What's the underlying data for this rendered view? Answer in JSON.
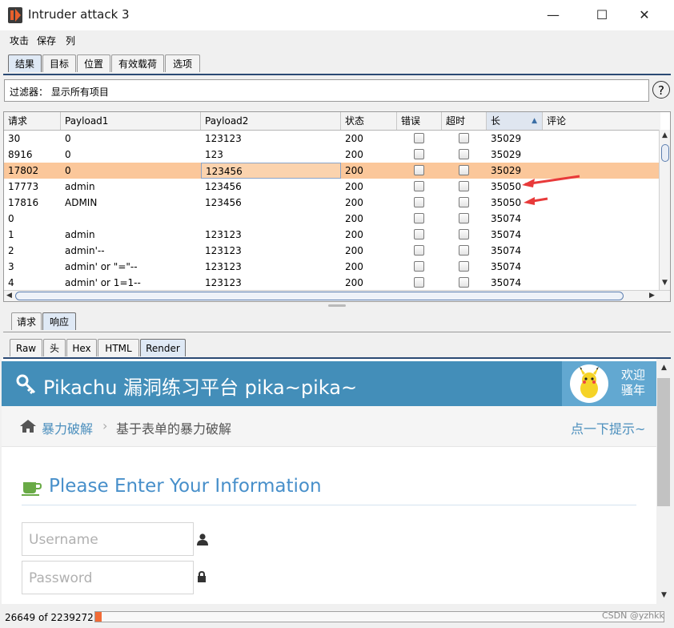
{
  "window": {
    "title": "Intruder attack 3",
    "minimize": "—",
    "maximize": "☐",
    "close": "✕"
  },
  "menu": [
    "攻击",
    "保存",
    "列"
  ],
  "main_tabs": [
    "结果",
    "目标",
    "位置",
    "有效载荷",
    "选项"
  ],
  "filter": {
    "text": "过滤器： 显示所有项目",
    "help": "?"
  },
  "table": {
    "columns": [
      "请求",
      "Payload1",
      "Payload2",
      "状态",
      "错误",
      "超时",
      "长",
      "评论"
    ],
    "sorted_column": "长",
    "rows": [
      {
        "req": "30",
        "p1": "0",
        "p2": "123123",
        "status": "200",
        "len": "35029"
      },
      {
        "req": "8916",
        "p1": "0",
        "p2": "123",
        "status": "200",
        "len": "35029"
      },
      {
        "req": "17802",
        "p1": "0",
        "p2": "123456",
        "status": "200",
        "len": "35029"
      },
      {
        "req": "17773",
        "p1": "admin",
        "p2": "123456",
        "status": "200",
        "len": "35050"
      },
      {
        "req": "17816",
        "p1": "ADMIN",
        "p2": "123456",
        "status": "200",
        "len": "35050"
      },
      {
        "req": "0",
        "p1": "",
        "p2": "",
        "status": "200",
        "len": "35074"
      },
      {
        "req": "1",
        "p1": "admin",
        "p2": "123123",
        "status": "200",
        "len": "35074"
      },
      {
        "req": "2",
        "p1": "admin'--",
        "p2": "123123",
        "status": "200",
        "len": "35074"
      },
      {
        "req": "3",
        "p1": "admin' or \"=\"--",
        "p2": "123123",
        "status": "200",
        "len": "35074"
      },
      {
        "req": "4",
        "p1": "admin' or 1=1--",
        "p2": "123123",
        "status": "200",
        "len": "35074"
      }
    ],
    "selected_row_index": 2
  },
  "detail_tabs": [
    "请求",
    "响应"
  ],
  "view_tabs": [
    "Raw",
    "头",
    "Hex",
    "HTML",
    "Render"
  ],
  "render": {
    "site_title": "Pikachu 漏洞练习平台 pika~pika~",
    "welcome_line1": "欢迎",
    "welcome_line2": "骚年",
    "breadcrumb_1": "暴力破解",
    "breadcrumb_sep": "›",
    "breadcrumb_2": "基于表单的暴力破解",
    "hint_link": "点一下提示~",
    "form_title": "Please Enter Your Information",
    "username_placeholder": "Username",
    "password_placeholder": "Password"
  },
  "status": {
    "text": "26649 of 2239272",
    "progress_fraction": 0.0119,
    "watermark": "CSDN @yzhkk"
  },
  "colors": {
    "selected_row": "#fbc79a",
    "pikachu_header": "#438eb9",
    "link": "#4c8fbd",
    "progress": "#f26b36"
  }
}
